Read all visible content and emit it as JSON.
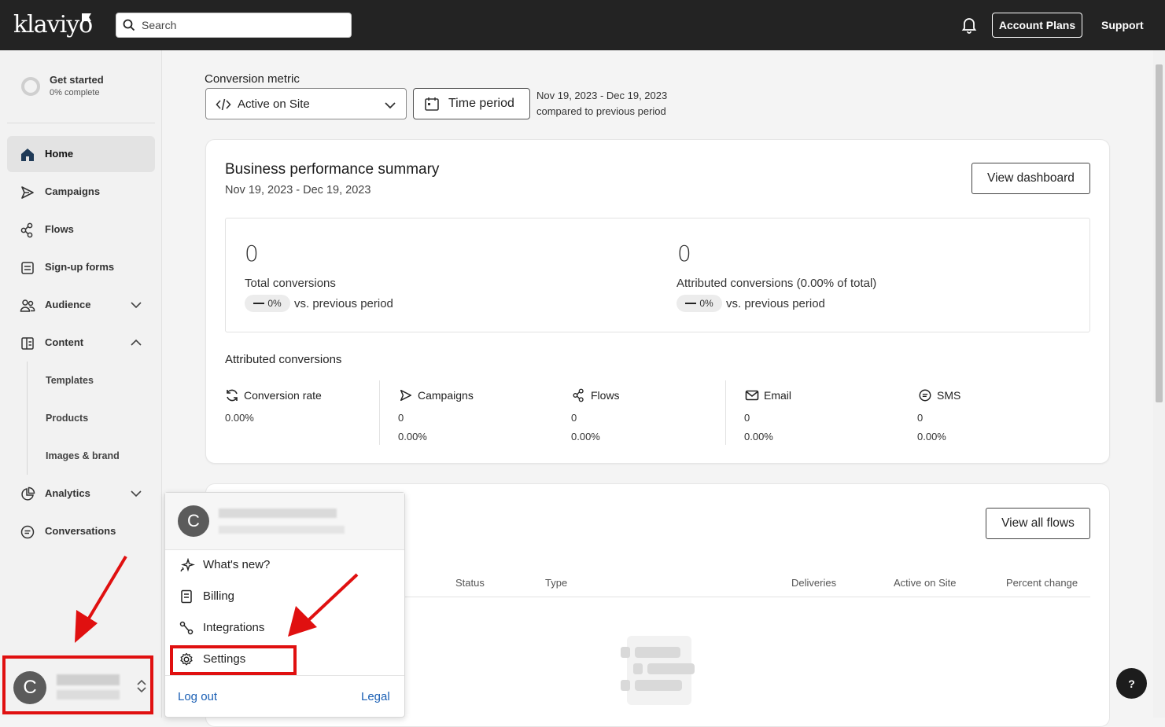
{
  "header": {
    "logo": "klaviyo",
    "search_placeholder": "Search",
    "account_plans": "Account Plans",
    "support": "Support"
  },
  "sidebar": {
    "get_started": {
      "title": "Get started",
      "progress": "0% complete"
    },
    "items": [
      {
        "label": "Home"
      },
      {
        "label": "Campaigns"
      },
      {
        "label": "Flows"
      },
      {
        "label": "Sign-up forms"
      },
      {
        "label": "Audience"
      },
      {
        "label": "Content"
      },
      {
        "label": "Analytics"
      },
      {
        "label": "Conversations"
      }
    ],
    "content_sub": [
      "Templates",
      "Products",
      "Images & brand"
    ],
    "user_initial": "C"
  },
  "controls": {
    "conversion_metric_label": "Conversion metric",
    "metric_value": "Active on Site",
    "time_period": "Time period",
    "date_range": "Nov 19, 2023 - Dec 19, 2023",
    "compared": "compared to previous period"
  },
  "summary": {
    "title": "Business performance summary",
    "range": "Nov 19, 2023 - Dec 19, 2023",
    "view_dashboard": "View dashboard",
    "total": {
      "value": "0",
      "label": "Total conversions",
      "change": "0%",
      "vs": "vs. previous period"
    },
    "attributed": {
      "value": "0",
      "label": "Attributed conversions (0.00% of total)",
      "change": "0%",
      "vs": "vs. previous period"
    },
    "attributed_title": "Attributed conversions",
    "metrics": [
      {
        "label": "Conversion rate",
        "v1": "0.00%",
        "v2": ""
      },
      {
        "label": "Campaigns",
        "v1": "0",
        "v2": "0.00%"
      },
      {
        "label": "Flows",
        "v1": "0",
        "v2": "0.00%"
      },
      {
        "label": "Email",
        "v1": "0",
        "v2": "0.00%"
      },
      {
        "label": "SMS",
        "v1": "0",
        "v2": "0.00%"
      }
    ]
  },
  "flows_card": {
    "view_all": "View all flows",
    "columns": [
      "Status",
      "Type",
      "Deliveries",
      "Active on Site",
      "Percent change"
    ]
  },
  "account_menu": {
    "initial": "C",
    "items": [
      "What's new?",
      "Billing",
      "Integrations",
      "Settings"
    ],
    "logout": "Log out",
    "legal": "Legal"
  },
  "help": "?",
  "colors": {
    "topbar": "#232323",
    "highlight": "#e01010",
    "link": "#1a5fb4"
  }
}
